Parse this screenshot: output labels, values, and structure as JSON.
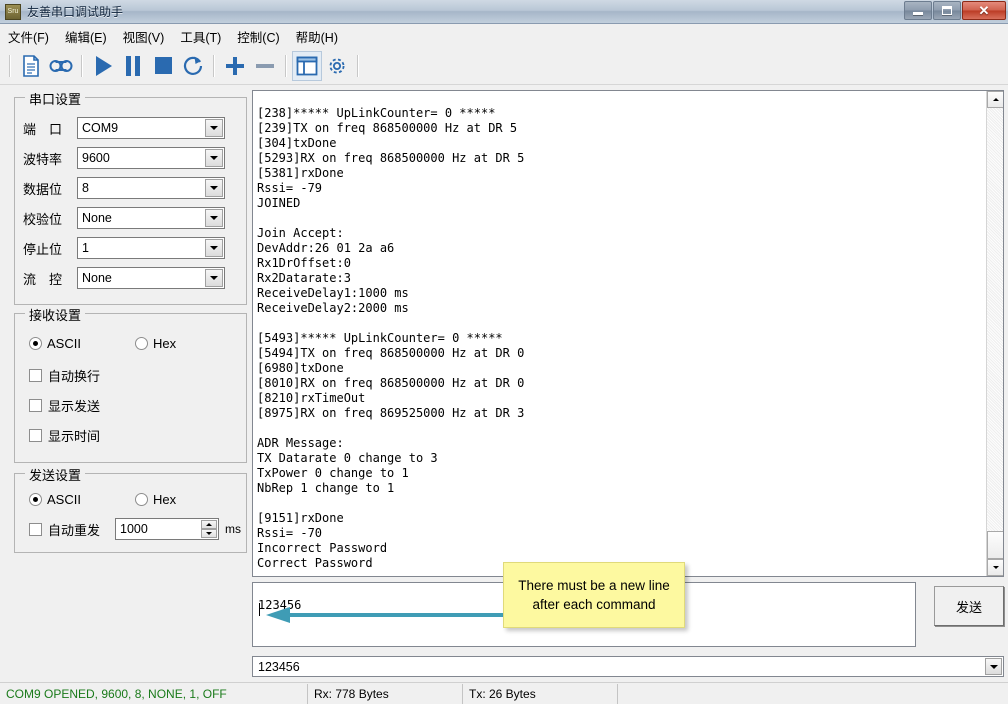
{
  "window": {
    "title": "友善串口调试助手",
    "app_icon": "serial-app-icon",
    "minimize_label": "—",
    "maximize_label": "□",
    "close_label": "✕"
  },
  "menubar": {
    "items": [
      {
        "label": "文件(F)",
        "name": "menu-file"
      },
      {
        "label": "编辑(E)",
        "name": "menu-edit"
      },
      {
        "label": "视图(V)",
        "name": "menu-view"
      },
      {
        "label": "工具(T)",
        "name": "menu-tools"
      },
      {
        "label": "控制(C)",
        "name": "menu-control"
      },
      {
        "label": "帮助(H)",
        "name": "menu-help"
      }
    ]
  },
  "toolbar": {
    "buttons": [
      {
        "icon": "document-icon",
        "active": false
      },
      {
        "icon": "tape-record-icon",
        "active": false
      },
      {
        "icon": "play-icon",
        "active": false
      },
      {
        "icon": "pause-icon",
        "active": false
      },
      {
        "icon": "stop-icon",
        "active": false
      },
      {
        "icon": "refresh-icon",
        "active": false
      },
      {
        "icon": "plus-icon",
        "active": false
      },
      {
        "icon": "minus-icon",
        "active": false
      },
      {
        "icon": "panel-layout-icon",
        "active": true
      },
      {
        "icon": "gear-icon",
        "active": false
      }
    ],
    "accent_color": "#2a6ab0"
  },
  "serial_settings": {
    "title": "串口设置",
    "fields": [
      {
        "label": "端　口",
        "value": "COM9",
        "name": "port"
      },
      {
        "label": "波特率",
        "value": "9600",
        "name": "baud-rate"
      },
      {
        "label": "数据位",
        "value": "8",
        "name": "data-bits"
      },
      {
        "label": "校验位",
        "value": "None",
        "name": "parity"
      },
      {
        "label": "停止位",
        "value": "1",
        "name": "stop-bits"
      },
      {
        "label": "流　控",
        "value": "None",
        "name": "flow-control"
      }
    ]
  },
  "receive_settings": {
    "title": "接收设置",
    "ascii_label": "ASCII",
    "hex_label": "Hex",
    "ascii_checked": true,
    "hex_checked": false,
    "checkboxes": [
      {
        "label": "自动换行",
        "checked": false,
        "name": "auto-wrap"
      },
      {
        "label": "显示发送",
        "checked": false,
        "name": "show-send"
      },
      {
        "label": "显示时间",
        "checked": false,
        "name": "show-time"
      }
    ]
  },
  "send_settings": {
    "title": "发送设置",
    "ascii_label": "ASCII",
    "hex_label": "Hex",
    "ascii_checked": true,
    "hex_checked": false,
    "auto_resend_label": "自动重发",
    "auto_resend_checked": false,
    "interval_value": "1000",
    "interval_unit": "ms"
  },
  "terminal": {
    "content": "[238]***** UpLinkCounter= 0 *****\n[239]TX on freq 868500000 Hz at DR 5\n[304]txDone\n[5293]RX on freq 868500000 Hz at DR 5\n[5381]rxDone\nRssi= -79\nJOINED\n\nJoin Accept:\nDevAddr:26 01 2a a6\nRx1DrOffset:0\nRx2Datarate:3\nReceiveDelay1:1000 ms\nReceiveDelay2:2000 ms\n\n[5493]***** UpLinkCounter= 0 *****\n[5494]TX on freq 868500000 Hz at DR 0\n[6980]txDone\n[8010]RX on freq 868500000 Hz at DR 0\n[8210]rxTimeOut\n[8975]RX on freq 869525000 Hz at DR 3\n\nADR Message:\nTX Datarate 0 change to 3\nTxPower 0 change to 1\nNbRep 1 change to 1\n\n[9151]rxDone\nRssi= -70\nIncorrect Password\nCorrect Password",
    "scroll_position": "bottom"
  },
  "send_area": {
    "input_value": "123456",
    "send_button_label": "发送"
  },
  "annotation": {
    "line1": "There  must be a new line",
    "line2": "after each command",
    "arrow_color": "#3f9cb5",
    "box_color": "#fdf9a0"
  },
  "history": {
    "value": "123456"
  },
  "statusbar": {
    "connection": "COM9 OPENED, 9600, 8, NONE, 1, OFF",
    "rx": "Rx: 778 Bytes",
    "tx": "Tx: 26 Bytes",
    "spare": "",
    "connection_color": "#1a7a1a"
  }
}
